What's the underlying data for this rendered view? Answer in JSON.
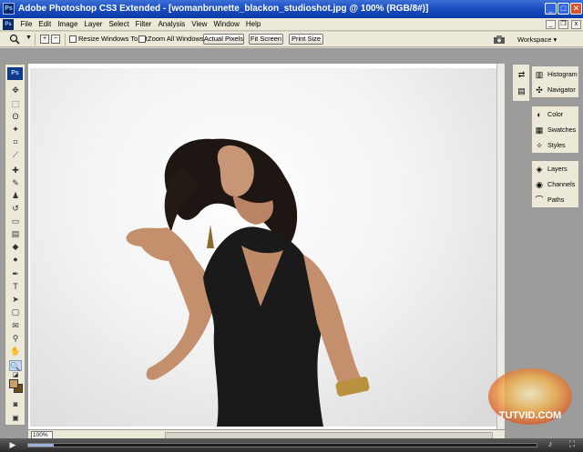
{
  "window": {
    "title": "Adobe Photoshop CS3 Extended - [womanbrunette_blackon_studioshot.jpg @ 100% (RGB/8#)]",
    "app_icon": "Ps",
    "minimize_icon": "_",
    "maximize_icon": "□",
    "close_icon": "✕"
  },
  "menu": {
    "items": [
      "File",
      "Edit",
      "Image",
      "Layer",
      "Select",
      "Filter",
      "Analysis",
      "View",
      "Window",
      "Help"
    ],
    "doc_min": "_",
    "doc_restore": "❐",
    "doc_close": "x"
  },
  "options": {
    "caret": "▼",
    "zoom_in": "+",
    "zoom_out": "−",
    "resize_windows": "Resize Windows To Fit",
    "zoom_all": "Zoom All Windows",
    "actual_pixels": "Actual Pixels",
    "fit_screen": "Fit Screen",
    "print_size": "Print Size",
    "workspace": "Workspace ▾"
  },
  "toolbox": {
    "logo": "Ps",
    "tools": [
      {
        "name": "move-tool-icon",
        "glyph": "✥"
      },
      {
        "name": "marquee-tool-icon",
        "glyph": "⬚"
      },
      {
        "name": "lasso-tool-icon",
        "glyph": "ʘ"
      },
      {
        "name": "magic-wand-tool-icon",
        "glyph": "✦"
      },
      {
        "name": "crop-tool-icon",
        "glyph": "⌗"
      },
      {
        "name": "slice-tool-icon",
        "glyph": "⟋"
      },
      {
        "name": "healing-brush-tool-icon",
        "glyph": "✚"
      },
      {
        "name": "brush-tool-icon",
        "glyph": "✎"
      },
      {
        "name": "clone-stamp-tool-icon",
        "glyph": "♟"
      },
      {
        "name": "history-brush-tool-icon",
        "glyph": "↺"
      },
      {
        "name": "eraser-tool-icon",
        "glyph": "▭"
      },
      {
        "name": "gradient-tool-icon",
        "glyph": "▤"
      },
      {
        "name": "blur-tool-icon",
        "glyph": "◆"
      },
      {
        "name": "dodge-tool-icon",
        "glyph": "●"
      },
      {
        "name": "pen-tool-icon",
        "glyph": "✒"
      },
      {
        "name": "type-tool-icon",
        "glyph": "T"
      },
      {
        "name": "path-selection-tool-icon",
        "glyph": "➤"
      },
      {
        "name": "shape-tool-icon",
        "glyph": "▢"
      },
      {
        "name": "notes-tool-icon",
        "glyph": "✉"
      },
      {
        "name": "eyedropper-tool-icon",
        "glyph": "⚲"
      },
      {
        "name": "hand-tool-icon",
        "glyph": "✋"
      },
      {
        "name": "zoom-tool-icon",
        "glyph": "🔍"
      }
    ],
    "default_colors_icon": "◪",
    "quick_mask_icon": "◙",
    "screen_mode_icon": "▣"
  },
  "document": {
    "zoom_value": "100%"
  },
  "dock": {
    "icon_a": "⇄",
    "icon_b": "▤"
  },
  "panels": {
    "group1": [
      {
        "label": "Histogram",
        "icon": "histogram-icon",
        "glyph": "▥"
      },
      {
        "label": "Navigator",
        "icon": "navigator-icon",
        "glyph": "✣"
      }
    ],
    "group2": [
      {
        "label": "Color",
        "icon": "color-icon",
        "glyph": "◐"
      },
      {
        "label": "Swatches",
        "icon": "swatches-icon",
        "glyph": "▦"
      },
      {
        "label": "Styles",
        "icon": "styles-icon",
        "glyph": "✧"
      }
    ],
    "group3": [
      {
        "label": "Layers",
        "icon": "layers-icon",
        "glyph": "◈"
      },
      {
        "label": "Channels",
        "icon": "channels-icon",
        "glyph": "◉"
      },
      {
        "label": "Paths",
        "icon": "paths-icon",
        "glyph": "⌒"
      }
    ]
  },
  "player": {
    "play_icon": "▶",
    "progress_fraction": 0.05,
    "volume_icon": "♪",
    "fullscreen_icon": "⛶"
  },
  "watermark": {
    "text": "TUTVID.COM"
  },
  "colors": {
    "title_bar": "#1b4fc2",
    "accent_ps": "#0f3b8a",
    "foreground_swatch": "#c9a165",
    "background_swatch": "#6b4a1d"
  }
}
